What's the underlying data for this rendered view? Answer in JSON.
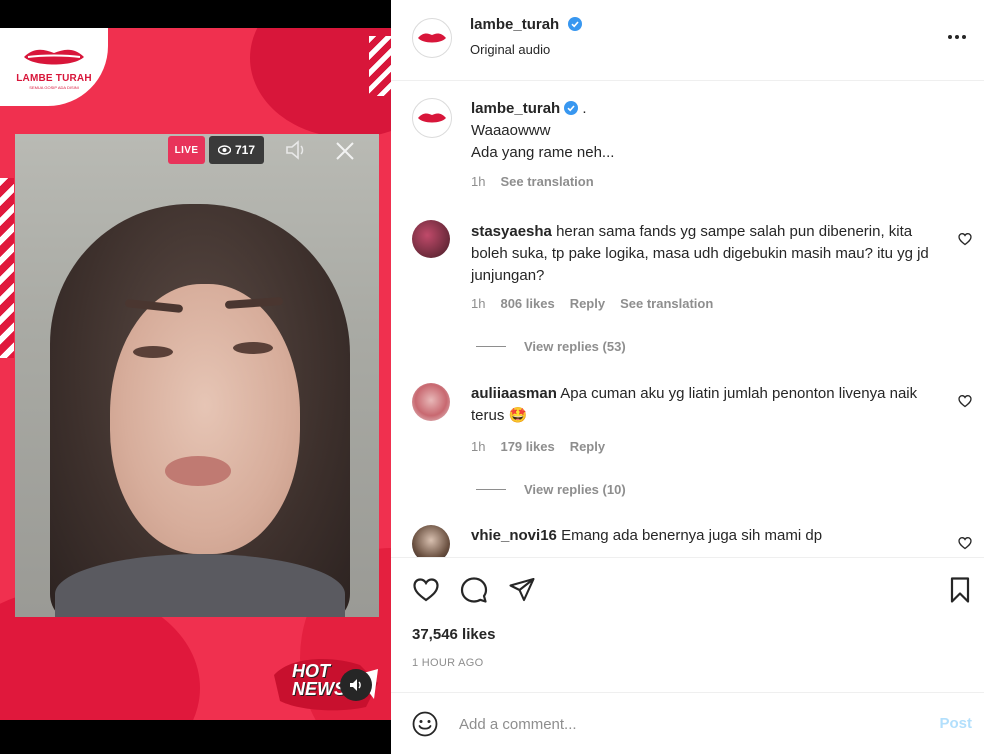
{
  "media": {
    "logo_text": "LAMBE TURAH",
    "logo_tagline": "SEMUA GOSIP ADA DISINI",
    "live_label": "LIVE",
    "viewer_count": "717",
    "hot_news_line1": "HOT",
    "hot_news_line2": "NEWS",
    "brand_color": "#f0304f"
  },
  "header": {
    "username": "lambe_turah",
    "subtitle": "Original audio",
    "verified": true
  },
  "caption": {
    "username": "lambe_turah",
    "suffix": " .",
    "line1": "Waaaowww",
    "line2": "Ada yang rame neh...",
    "time": "1h",
    "see_translation": "See translation"
  },
  "comments": [
    {
      "username": "stasyaesha",
      "text": "heran sama fands yg sampe salah pun dibenerin, kita boleh suka, tp pake logika, masa udh digebukin masih mau? itu yg jd junjungan?",
      "time": "1h",
      "likes": "806 likes",
      "reply": "Reply",
      "see_translation": "See translation",
      "view_replies": "View replies (53)"
    },
    {
      "username": "auliiaasman",
      "text": "Apa cuman aku yg liatin jumlah penonton livenya naik terus 🤩",
      "time": "1h",
      "likes": "179 likes",
      "reply": "Reply",
      "view_replies": "View replies (10)"
    },
    {
      "username": "vhie_novi16",
      "text": "Emang ada benernya juga sih mami dp"
    }
  ],
  "actions": {
    "likes": "37,546 likes",
    "timestamp": "1 HOUR AGO"
  },
  "add_comment": {
    "placeholder": "Add a comment...",
    "post_label": "Post"
  },
  "colors": {
    "verified": "#3897f0",
    "muted": "#8e8e8e",
    "post_disabled": "#b2dffc"
  }
}
